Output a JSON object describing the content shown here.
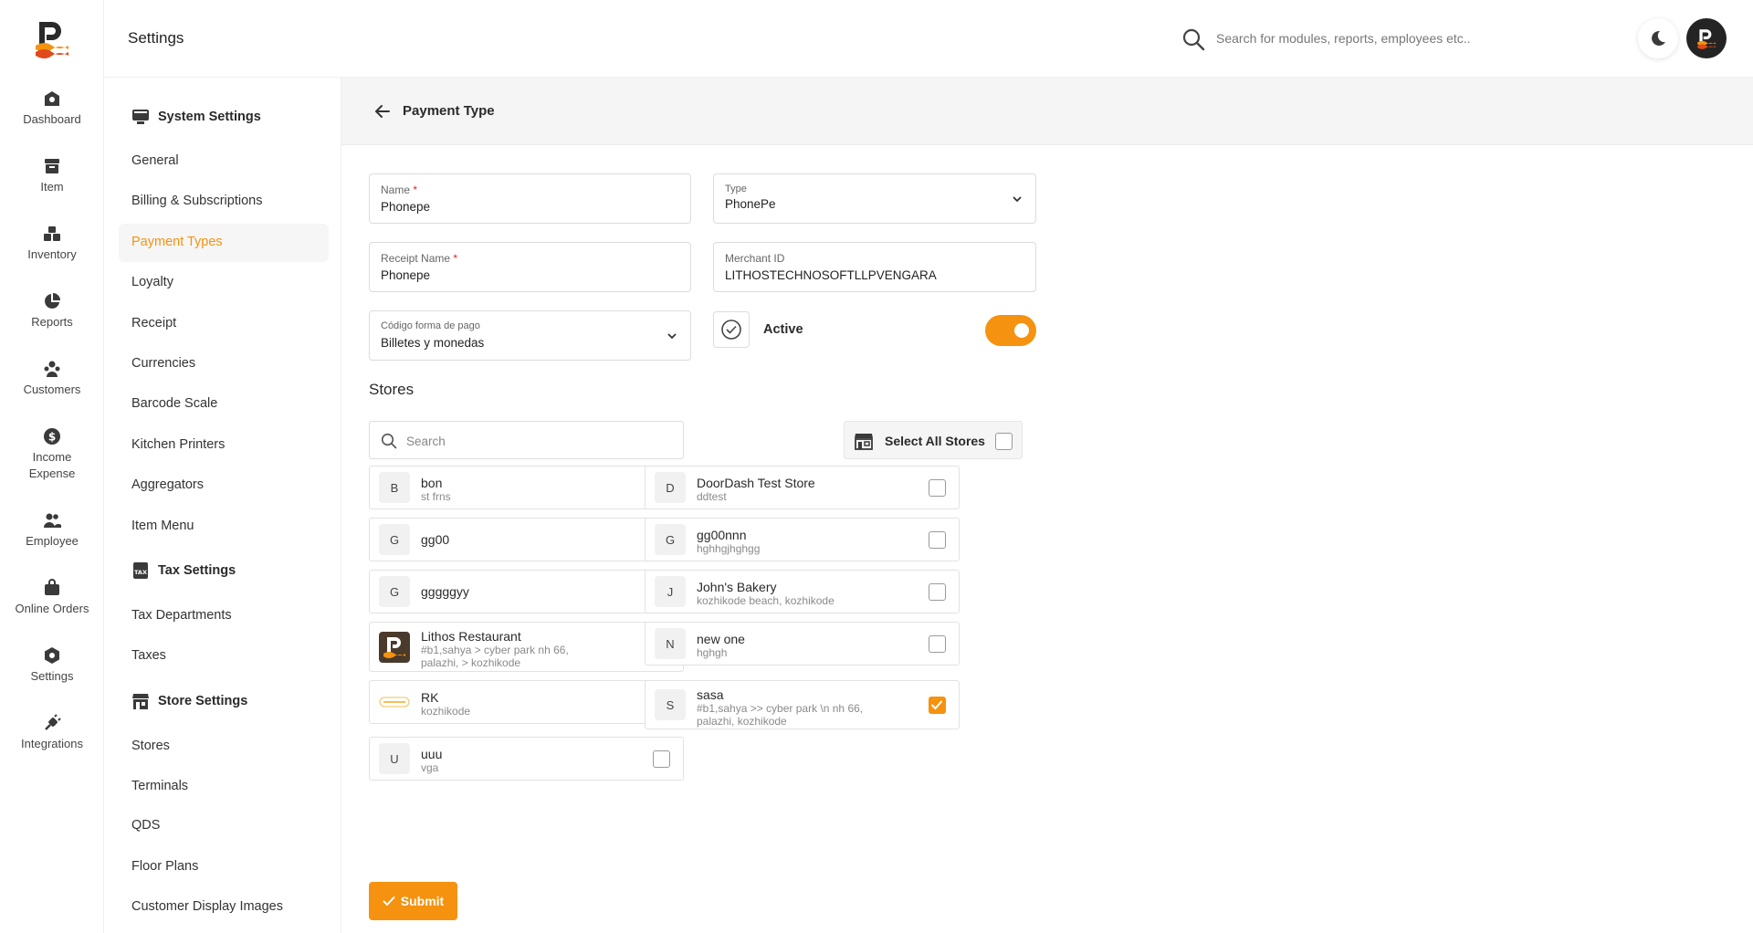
{
  "header": {
    "title": "Settings",
    "search_placeholder": "Search for modules, reports, employees etc.."
  },
  "rail": [
    {
      "label": "Dashboard",
      "icon": "dashboard-icon"
    },
    {
      "label": "Item",
      "icon": "item-icon"
    },
    {
      "label": "Inventory",
      "icon": "inventory-icon"
    },
    {
      "label": "Reports",
      "icon": "reports-pie-icon"
    },
    {
      "label": "Customers",
      "icon": "customers-icon"
    },
    {
      "label": "Income Expense",
      "icon": "income-expense-icon"
    },
    {
      "label": "Employee",
      "icon": "employee-icon"
    },
    {
      "label": "Online Orders",
      "icon": "online-orders-icon"
    },
    {
      "label": "Settings",
      "icon": "settings-icon"
    },
    {
      "label": "Integrations",
      "icon": "integrations-icon"
    }
  ],
  "settings_nav": {
    "system_title": "System Settings",
    "system_items": [
      "General",
      "Billing & Subscriptions",
      "Payment Types",
      "Loyalty",
      "Receipt",
      "Currencies",
      "Barcode Scale",
      "Kitchen Printers",
      "Aggregators",
      "Item Menu"
    ],
    "tax_title": "Tax Settings",
    "tax_items": [
      "Tax Departments",
      "Taxes"
    ],
    "store_title": "Store Settings",
    "store_items": [
      "Stores",
      "Terminals",
      "QDS",
      "Floor Plans",
      "Customer Display Images"
    ],
    "active_item": "Payment Types"
  },
  "form": {
    "page_title": "Payment Type",
    "name_label": "Name",
    "name_value": "Phonepe",
    "type_label": "Type",
    "type_value": "PhonePe",
    "receipt_label": "Receipt Name",
    "receipt_value": "Phonepe",
    "merchant_label": "Merchant ID",
    "merchant_value": "LITHOSTECHNOSOFTLLPVENGARA",
    "codigo_label": "Código forma de pago",
    "codigo_value": "Billetes y monedas",
    "required_mark": "*",
    "active_label": "Active",
    "active_on": true
  },
  "stores": {
    "title": "Stores",
    "search_placeholder": "Search",
    "select_all_label": "Select All Stores",
    "left": [
      {
        "initial": "B",
        "name": "bon",
        "address": "st frns",
        "checked": true
      },
      {
        "initial": "G",
        "name": "gg00",
        "address": "",
        "checked": false
      },
      {
        "initial": "G",
        "name": "gggggyy",
        "address": "",
        "checked": false
      },
      {
        "initial": "",
        "name": "Lithos Restaurant",
        "address": "#b1,sahya > cyber park nh 66, palazhi, > kozhikode",
        "checked": true,
        "logo": "lithos-logo"
      },
      {
        "initial": "",
        "name": "RK",
        "address": "kozhikode",
        "checked": true,
        "logo": "rk-logo"
      },
      {
        "initial": "U",
        "name": "uuu",
        "address": "vga",
        "checked": false
      }
    ],
    "right": [
      {
        "initial": "D",
        "name": "DoorDash Test Store",
        "address": "ddtest",
        "checked": false
      },
      {
        "initial": "G",
        "name": "gg00nnn",
        "address": "hghhgjhghgg",
        "checked": false
      },
      {
        "initial": "J",
        "name": "John's Bakery",
        "address": "kozhikode beach, kozhikode",
        "checked": false
      },
      {
        "initial": "N",
        "name": "new one",
        "address": "hghgh",
        "checked": false
      },
      {
        "initial": "S",
        "name": "sasa",
        "address": "#b1,sahya >> cyber park \\n nh 66, palazhi, kozhikode",
        "checked": true
      }
    ]
  },
  "submit_label": "Submit",
  "colors": {
    "accent": "#f5920f",
    "required": "#e0251b"
  }
}
